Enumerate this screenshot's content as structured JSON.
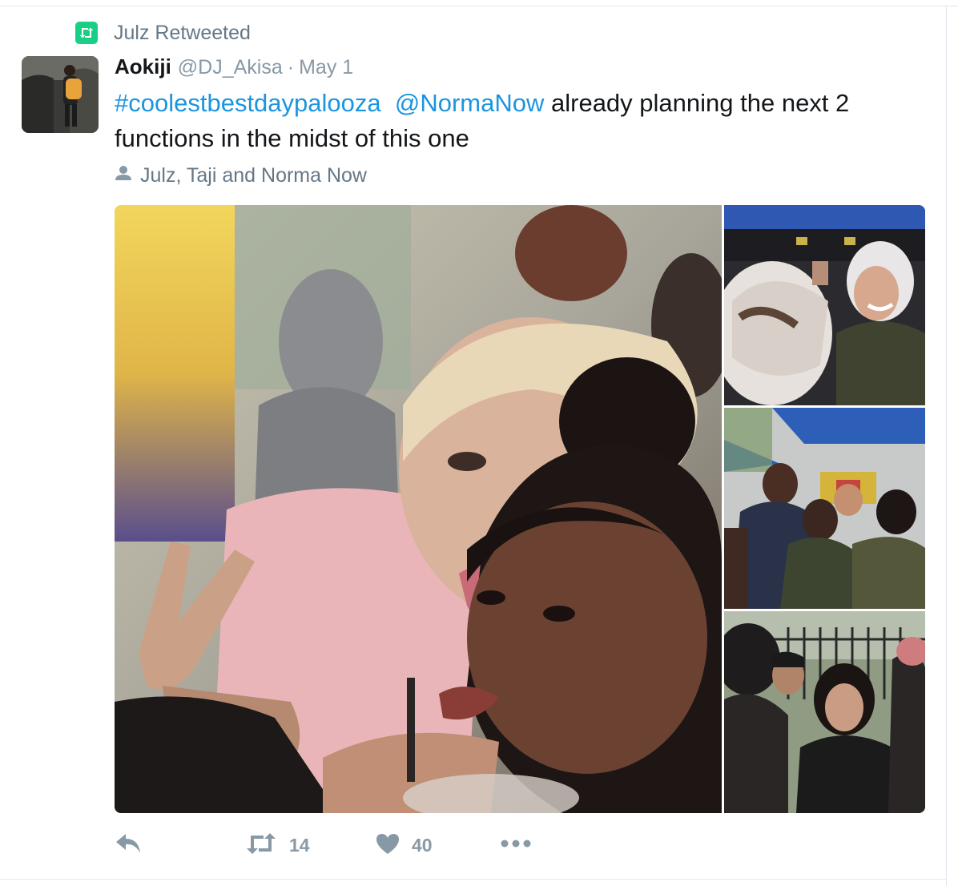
{
  "context": {
    "label": "Julz Retweeted",
    "icon": "retweet-icon",
    "badge_color": "#19cf86"
  },
  "tweet": {
    "fullname": "Aokiji",
    "username": "@DJ_Akisa",
    "separator": "·",
    "timestamp": "May 1",
    "hashtag": "#coolestbestdaypalooza",
    "mention": "@NormaNow",
    "text": "already planning the next 2 functions in the midst of this one",
    "link_color": "#1b95e0",
    "tagged_icon": "person-icon",
    "tagged_users": "Julz, Taji and Norma Now"
  },
  "media": {
    "photos": [
      {
        "name": "photo-main",
        "description_icon": "photo"
      },
      {
        "name": "photo-1",
        "description_icon": "photo"
      },
      {
        "name": "photo-2",
        "description_icon": "photo"
      },
      {
        "name": "photo-3",
        "description_icon": "photo"
      }
    ]
  },
  "actions": {
    "reply_icon": "reply-icon",
    "retweet_icon": "retweet-icon",
    "retweet_count": "14",
    "like_icon": "heart-icon",
    "like_count": "40",
    "more_icon": "more-icon",
    "icon_color": "#8899a6"
  }
}
